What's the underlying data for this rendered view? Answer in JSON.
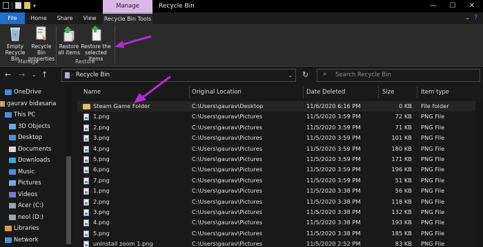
{
  "window": {
    "title": "Recycle Bin",
    "contextual_tab": "Manage",
    "contextual_group": "Recycle Bin Tools"
  },
  "ribbon_tabs": [
    "File",
    "Home",
    "Share",
    "View"
  ],
  "ribbon": {
    "manage_group": {
      "label": "Manage",
      "buttons": [
        {
          "line1": "Empty",
          "line2": "Recycle Bin"
        },
        {
          "line1": "Recycle Bin",
          "line2": "properties"
        }
      ]
    },
    "restore_group": {
      "label": "Restore",
      "buttons": [
        {
          "line1": "Restore",
          "line2": "all items"
        },
        {
          "line1": "Restore the",
          "line2": "selected items"
        }
      ]
    }
  },
  "address": {
    "location": "Recycle Bin",
    "search_placeholder": "Search Recycle Bin"
  },
  "nav": [
    {
      "label": "OneDrive",
      "icon": "cloud-icon"
    },
    {
      "label": "gaurav bidasaria",
      "icon": "user-icon"
    },
    {
      "label": "This PC",
      "icon": "computer-icon"
    },
    {
      "label": "3D Objects",
      "icon": "cube-icon"
    },
    {
      "label": "Desktop",
      "icon": "desktop-icon"
    },
    {
      "label": "Documents",
      "icon": "documents-icon"
    },
    {
      "label": "Downloads",
      "icon": "download-icon"
    },
    {
      "label": "Music",
      "icon": "music-icon"
    },
    {
      "label": "Pictures",
      "icon": "pictures-icon"
    },
    {
      "label": "Videos",
      "icon": "videos-icon"
    },
    {
      "label": "Acer (C:)",
      "icon": "drive-icon"
    },
    {
      "label": "neol (D:)",
      "icon": "drive-icon"
    },
    {
      "label": "Libraries",
      "icon": "libraries-icon"
    },
    {
      "label": "Network",
      "icon": "network-icon"
    }
  ],
  "columns": [
    "Name",
    "Original Location",
    "Date Deleted",
    "Size",
    "Item type"
  ],
  "files": [
    {
      "name": "Steam Game Folder",
      "location": "C:\\Users\\gaurav\\Desktop",
      "date": "11/6/2020 6:16 PM",
      "size": "0 KB",
      "type": "File folder"
    },
    {
      "name": "1.png",
      "location": "C:\\Users\\gaurav\\Pictures",
      "date": "11/5/2020 3:59 PM",
      "size": "72 KB",
      "type": "PNG File"
    },
    {
      "name": "2.png",
      "location": "C:\\Users\\gaurav\\Pictures",
      "date": "11/5/2020 3:59 PM",
      "size": "71 KB",
      "type": "PNG File"
    },
    {
      "name": "3.png",
      "location": "C:\\Users\\gaurav\\Pictures",
      "date": "11/5/2020 3:59 PM",
      "size": "101 KB",
      "type": "PNG File"
    },
    {
      "name": "4.png",
      "location": "C:\\Users\\gaurav\\Pictures",
      "date": "11/5/2020 3:59 PM",
      "size": "180 KB",
      "type": "PNG File"
    },
    {
      "name": "5.png",
      "location": "C:\\Users\\gaurav\\Pictures",
      "date": "11/5/2020 3:59 PM",
      "size": "171 KB",
      "type": "PNG File"
    },
    {
      "name": "6.png",
      "location": "C:\\Users\\gaurav\\Pictures",
      "date": "11/5/2020 3:59 PM",
      "size": "196 KB",
      "type": "PNG File"
    },
    {
      "name": "7.png",
      "location": "C:\\Users\\gaurav\\Pictures",
      "date": "11/5/2020 3:59 PM",
      "size": "51 KB",
      "type": "PNG File"
    },
    {
      "name": "1.png",
      "location": "C:\\Users\\gaurav\\Pictures",
      "date": "11/5/2020 3:38 PM",
      "size": "56 KB",
      "type": "PNG File"
    },
    {
      "name": "2.png",
      "location": "C:\\Users\\gaurav\\Pictures",
      "date": "11/5/2020 3:38 PM",
      "size": "118 KB",
      "type": "PNG File"
    },
    {
      "name": "3.png",
      "location": "C:\\Users\\gaurav\\Pictures",
      "date": "11/5/2020 3:38 PM",
      "size": "132 KB",
      "type": "PNG File"
    },
    {
      "name": "4.png",
      "location": "C:\\Users\\gaurav\\Pictures",
      "date": "11/5/2020 3:38 PM",
      "size": "193 KB",
      "type": "PNG File"
    },
    {
      "name": "5.png",
      "location": "C:\\Users\\gaurav\\Pictures",
      "date": "11/5/2020 3:38 PM",
      "size": "185 KB",
      "type": "PNG File"
    },
    {
      "name": "uninstall zoom 1.png",
      "location": "C:\\Users\\gaurav\\Pictures",
      "date": "11/5/2020 2:52 PM",
      "size": "83 KB",
      "type": "PNG File"
    }
  ],
  "colors": {
    "accent": "#1f6fc8",
    "manage_tab": "#d9b8e6",
    "annotation_arrow": "#b32bd6"
  }
}
